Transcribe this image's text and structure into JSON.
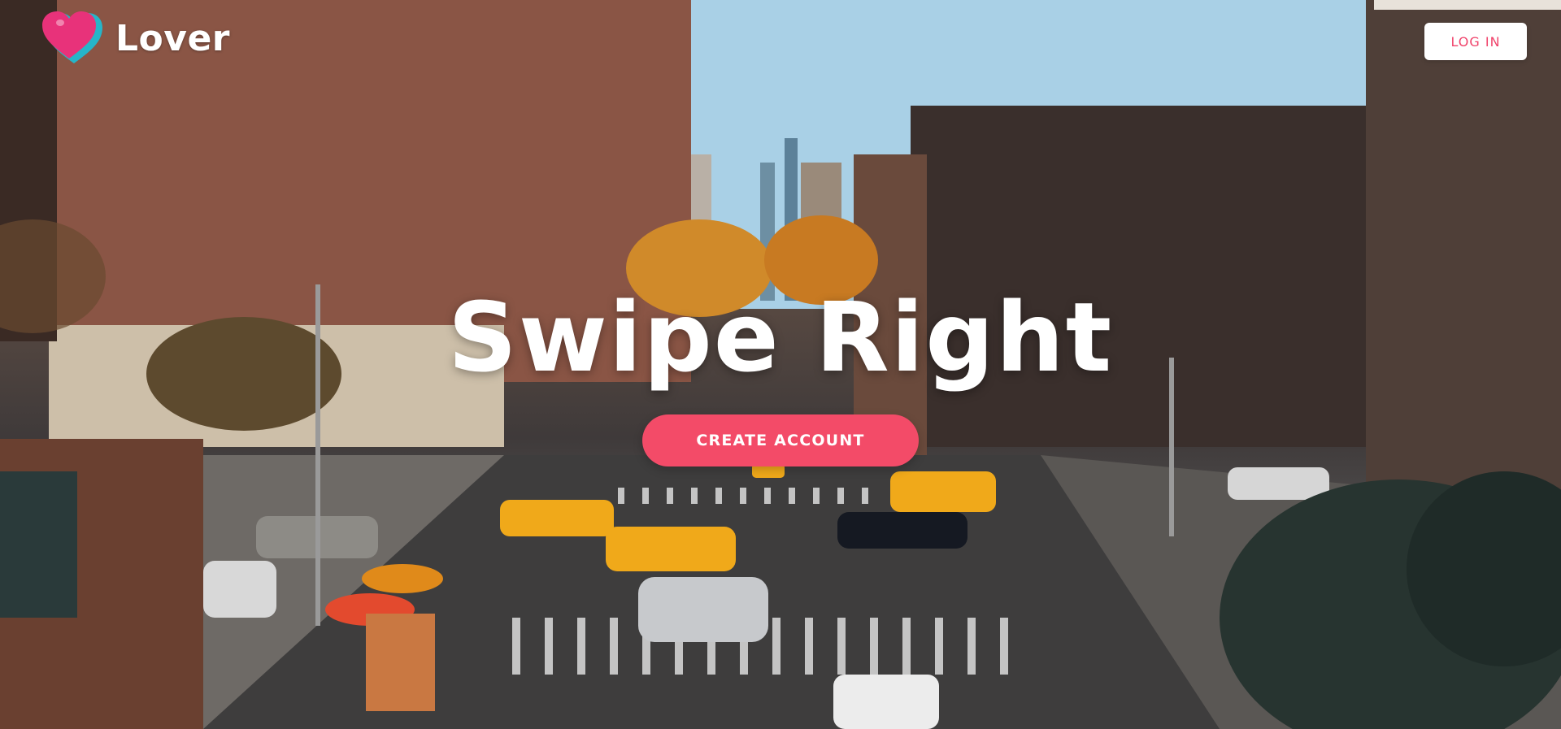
{
  "brand": {
    "name": "Lover",
    "logo_icon": "heart-pin-logo-icon",
    "colors": {
      "primary": "#f34b68",
      "logo_pink": "#e8327a",
      "logo_teal": "#26b5c9"
    }
  },
  "header": {
    "login_label": "LOG IN"
  },
  "hero": {
    "title": "Swipe Right",
    "cta_label": "CREATE ACCOUNT",
    "background": "city-street-photo"
  }
}
